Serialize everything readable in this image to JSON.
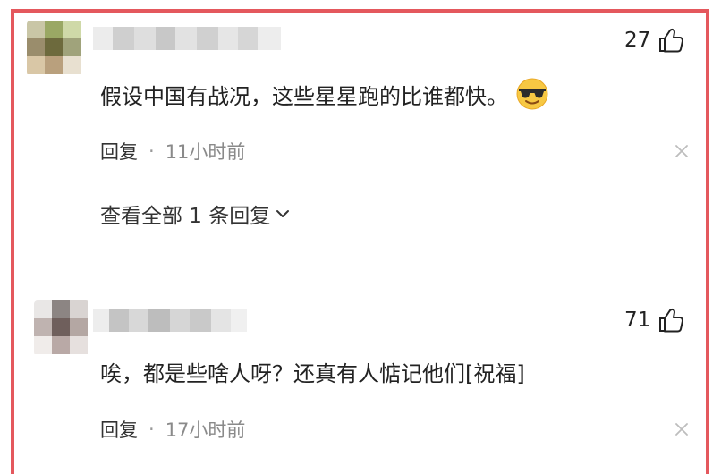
{
  "comments": [
    {
      "likes": "27",
      "text": "假设中国有战况，这些星星跑的比谁都快。",
      "emoji": "sunglasses-face",
      "reply_label": "回复",
      "separator": "·",
      "time": "11小时前",
      "view_replies": "查看全部 1 条回复"
    },
    {
      "likes": "71",
      "text": "唉，都是些啥人呀？还真有人惦记他们[祝福]",
      "reply_label": "回复",
      "separator": "·",
      "time": "17小时前"
    }
  ],
  "colors": {
    "frame_border": "#e4585d",
    "muted_text": "#8a8a8a",
    "close": "#bdbdbd"
  }
}
